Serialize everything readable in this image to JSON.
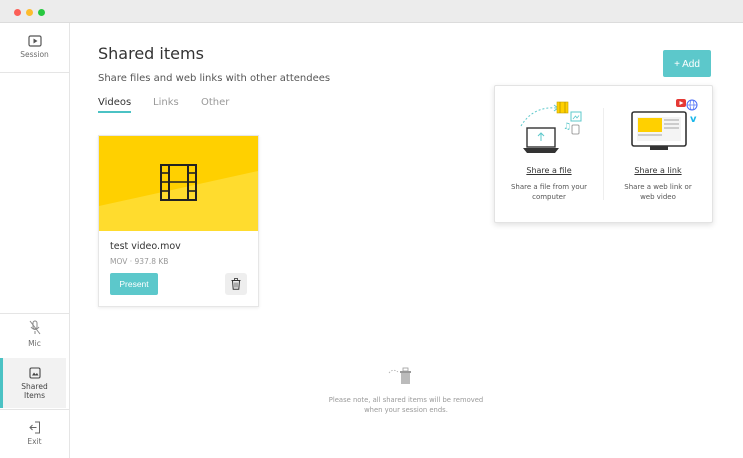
{
  "sidebar": {
    "session_label": "Session",
    "mic_label": "Mic",
    "shared_label_line1": "Shared",
    "shared_label_line2": "Items",
    "exit_label": "Exit"
  },
  "main": {
    "title": "Shared items",
    "subtitle": "Share files and web links with other attendees",
    "tabs": [
      {
        "label": "Videos",
        "active": true
      },
      {
        "label": "Links",
        "active": false
      },
      {
        "label": "Other",
        "active": false
      }
    ],
    "add_button": "+ Add"
  },
  "popover": {
    "file": {
      "title": "Share a file",
      "desc_line1": "Share a file from your",
      "desc_line2": "computer"
    },
    "link": {
      "title": "Share a link",
      "desc_line1": "Share a web link or",
      "desc_line2": "web video"
    }
  },
  "card": {
    "filename": "test video.mov",
    "meta": "MOV · 937.8 KB",
    "present_label": "Present"
  },
  "note": {
    "line1": "Please note, all shared items will be removed",
    "line2": "when your session ends."
  },
  "colors": {
    "accent": "#5cc8cb",
    "thumb": "#ffd000"
  }
}
